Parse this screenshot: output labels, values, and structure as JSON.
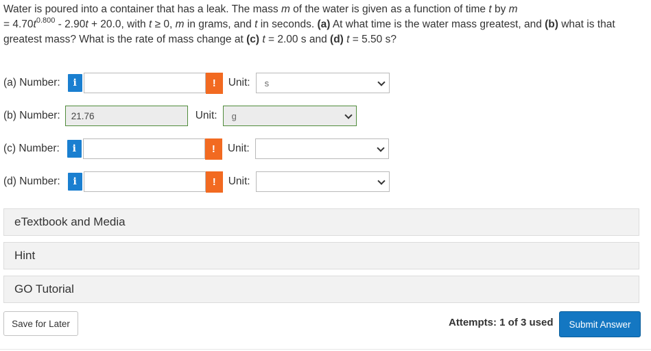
{
  "problem": {
    "p1": "Water is poured into a container that has a leak. The mass ",
    "m1": "m",
    "p2": " of the water is given as a function of time ",
    "t1": "t",
    "p3": " by ",
    "m2": "m",
    "p4": " = 4.70",
    "t2": "t",
    "exp": "0.800",
    "p5": " - 2.90",
    "t3": "t",
    "p6": " + 20.0, with ",
    "t4": "t",
    "p7": " ≥ 0, ",
    "m3": "m",
    "p8": " in grams, and ",
    "t5": "t",
    "p9": " in seconds. ",
    "a": "(a)",
    "p10": " At what time is the water mass greatest, and ",
    "b": "(b)",
    "p11": " what is that greatest mass? What is the rate of mass change at ",
    "c": "(c)",
    "p12": " ",
    "t6": "t",
    "p13": " = 2.00 s and ",
    "d": "(d)",
    "p14": " ",
    "t7": "t",
    "p15": " = 5.50 s?"
  },
  "parts": [
    {
      "label": "(a) Number:",
      "info": "i",
      "value": "",
      "warn": "!",
      "unit_label": "Unit:",
      "unit_value": "s"
    },
    {
      "label": "(b) Number:",
      "value": "21.76",
      "unit_label": "Unit:",
      "unit_value": "g"
    },
    {
      "label": "(c) Number:",
      "info": "i",
      "value": "",
      "warn": "!",
      "unit_label": "Unit:",
      "unit_value": ""
    },
    {
      "label": "(d) Number:",
      "info": "i",
      "value": "",
      "warn": "!",
      "unit_label": "Unit:",
      "unit_value": ""
    }
  ],
  "panels": {
    "etextbook": "eTextbook and Media",
    "hint": "Hint",
    "go_tutorial": "GO Tutorial"
  },
  "footer": {
    "save_label": "Save for Later",
    "attempts": "Attempts: 1 of 3 used",
    "submit_label": "Submit Answer"
  },
  "colors": {
    "info_blue": "#1a7fd0",
    "warn_orange": "#f26a21",
    "correct_green": "#4f8b3a",
    "submit_blue": "#1477c2"
  },
  "icons": {
    "info": "info-icon",
    "warning": "warning-icon",
    "dropdown": "chevron-down-icon"
  }
}
